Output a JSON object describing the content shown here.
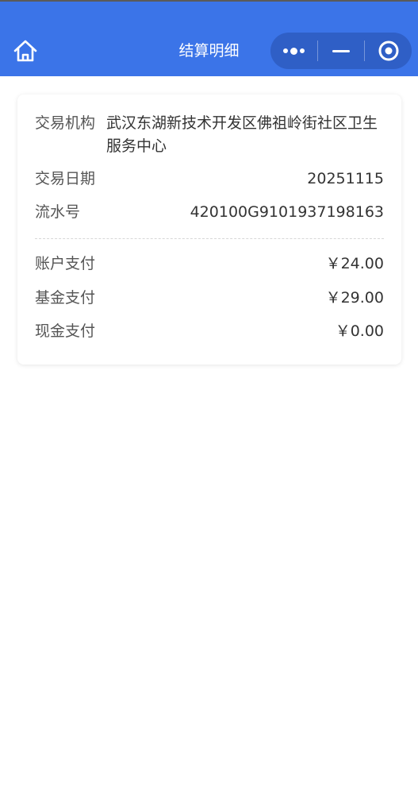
{
  "header": {
    "title": "结算明细",
    "home_icon": "home-icon",
    "more_icon": "more-dots-icon",
    "minimize_icon": "minimize-icon",
    "close_icon": "target-close-icon",
    "bg_color": "#3b74e8"
  },
  "detail": {
    "institution_label": "交易机构",
    "institution_value": "武汉东湖新技术开发区佛祖岭街社区卫生服务中心",
    "date_label": "交易日期",
    "date_value": "20251115",
    "serial_label": "流水号",
    "serial_value": "420100G9101937198163",
    "account_pay_label": "账户支付",
    "account_pay_value": "￥24.00",
    "fund_pay_label": "基金支付",
    "fund_pay_value": "￥29.00",
    "cash_pay_label": "现金支付",
    "cash_pay_value": "￥0.00"
  }
}
